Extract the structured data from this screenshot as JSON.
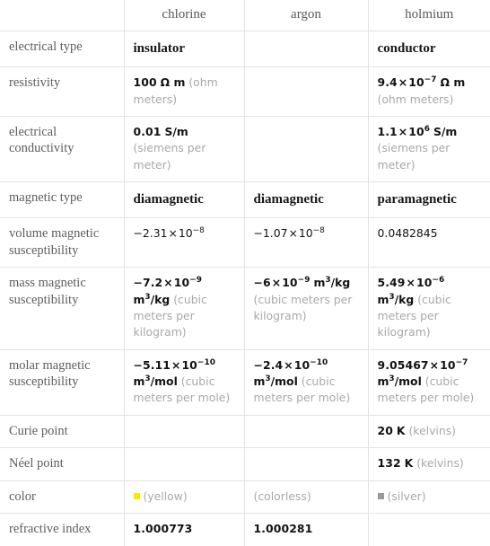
{
  "table": {
    "columns": [
      "",
      "chlorine",
      "argon",
      "holmium"
    ],
    "rows": [
      {
        "label": "electrical type",
        "cells": [
          {
            "kind": "word",
            "text": "insulator"
          },
          {
            "kind": "empty",
            "text": ""
          },
          {
            "kind": "word",
            "text": "conductor"
          }
        ]
      },
      {
        "label": "resistivity",
        "cells": [
          {
            "kind": "sci",
            "mantissa": "100",
            "exponent": "",
            "unit": "Ω m",
            "note": "(ohm meters)"
          },
          {
            "kind": "empty",
            "text": ""
          },
          {
            "kind": "sci",
            "mantissa": "9.4",
            "exponent": "−7",
            "unit": "Ω m",
            "note": "(ohm meters)"
          }
        ]
      },
      {
        "label": "electrical conductivity",
        "cells": [
          {
            "kind": "sci",
            "mantissa": "0.01",
            "exponent": "",
            "unit": "S/m",
            "note": "(siemens per meter)"
          },
          {
            "kind": "empty",
            "text": ""
          },
          {
            "kind": "sci",
            "mantissa": "1.1",
            "exponent": "6",
            "unit": "S/m",
            "note": "(siemens per meter)"
          }
        ]
      },
      {
        "label": "magnetic type",
        "cells": [
          {
            "kind": "word",
            "text": "diamagnetic"
          },
          {
            "kind": "word",
            "text": "diamagnetic"
          },
          {
            "kind": "word",
            "text": "paramagnetic"
          }
        ]
      },
      {
        "label": "volume magnetic susceptibility",
        "cells": [
          {
            "kind": "sci",
            "mantissa": "−2.31",
            "exponent": "−8",
            "unit": "",
            "note": "",
            "plain": true
          },
          {
            "kind": "sci",
            "mantissa": "−1.07",
            "exponent": "−8",
            "unit": "",
            "note": "",
            "plain": true
          },
          {
            "kind": "sci",
            "mantissa": "0.0482845",
            "exponent": "",
            "unit": "",
            "note": "",
            "plain": true
          }
        ]
      },
      {
        "label": "mass magnetic susceptibility",
        "cells": [
          {
            "kind": "sci",
            "mantissa": "−7.2",
            "exponent": "−9",
            "unit": "m³/kg",
            "note": "(cubic meters per kilogram)"
          },
          {
            "kind": "sci",
            "mantissa": "−6",
            "exponent": "−9",
            "unit": "m³/kg",
            "note": "(cubic meters per kilogram)"
          },
          {
            "kind": "sci",
            "mantissa": "5.49",
            "exponent": "−6",
            "unit": "m³/kg",
            "note": "(cubic meters per kilogram)"
          }
        ]
      },
      {
        "label": "molar magnetic susceptibility",
        "cells": [
          {
            "kind": "sci",
            "mantissa": "−5.11",
            "exponent": "−10",
            "unit": "m³/mol",
            "note": "(cubic meters per mole)"
          },
          {
            "kind": "sci",
            "mantissa": "−2.4",
            "exponent": "−10",
            "unit": "m³/mol",
            "note": "(cubic meters per mole)"
          },
          {
            "kind": "sci",
            "mantissa": "9.05467",
            "exponent": "−7",
            "unit": "m³/mol",
            "note": "(cubic meters per mole)"
          }
        ]
      },
      {
        "label": "Curie point",
        "cells": [
          {
            "kind": "empty",
            "text": ""
          },
          {
            "kind": "empty",
            "text": ""
          },
          {
            "kind": "sci",
            "mantissa": "20",
            "exponent": "",
            "unit": "K",
            "note": "(kelvins)"
          }
        ]
      },
      {
        "label": "Néel point",
        "cells": [
          {
            "kind": "empty",
            "text": ""
          },
          {
            "kind": "empty",
            "text": ""
          },
          {
            "kind": "sci",
            "mantissa": "132",
            "exponent": "",
            "unit": "K",
            "note": "(kelvins)"
          }
        ]
      },
      {
        "label": "color",
        "cells": [
          {
            "kind": "color",
            "swatch": "#ffe800",
            "note": "(yellow)"
          },
          {
            "kind": "color",
            "swatch": "",
            "note": "(colorless)"
          },
          {
            "kind": "color",
            "swatch": "#999999",
            "note": "(silver)"
          }
        ]
      },
      {
        "label": "refractive index",
        "cells": [
          {
            "kind": "sci",
            "mantissa": "1.000773",
            "exponent": "",
            "unit": "",
            "note": ""
          },
          {
            "kind": "sci",
            "mantissa": "1.000281",
            "exponent": "",
            "unit": "",
            "note": ""
          },
          {
            "kind": "empty",
            "text": ""
          }
        ]
      }
    ]
  }
}
